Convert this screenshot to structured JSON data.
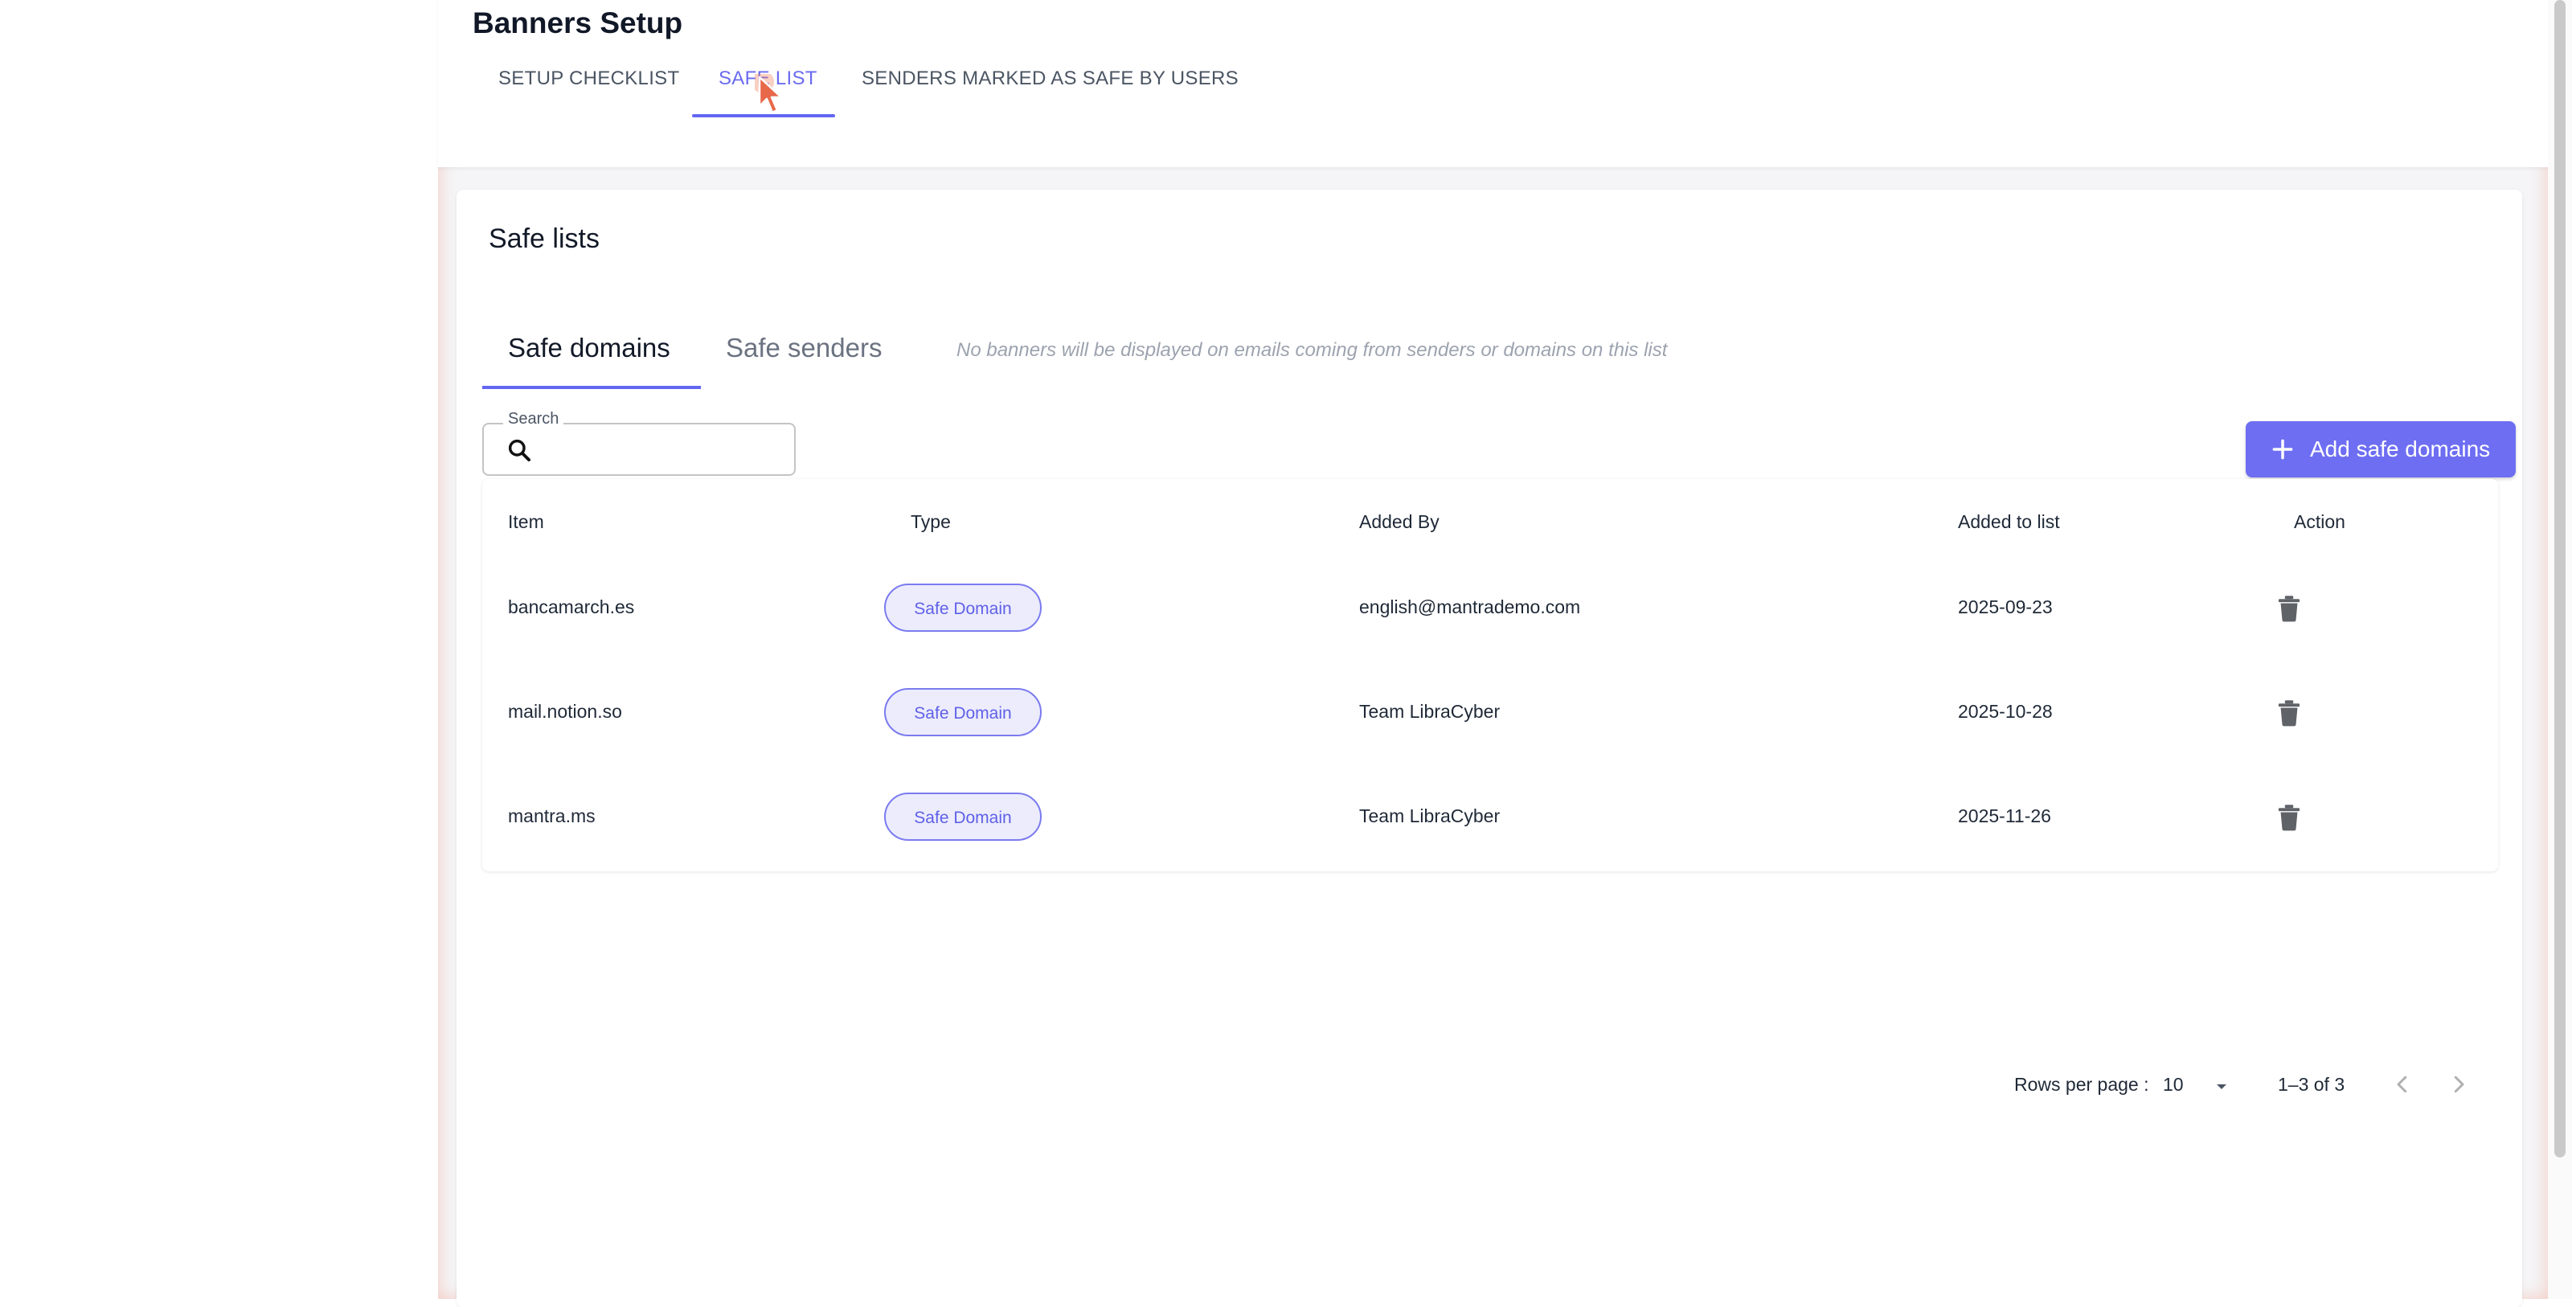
{
  "header": {
    "title": "Banners Setup",
    "tabs": [
      {
        "label": "SETUP CHECKLIST",
        "active": false
      },
      {
        "label": "SAFE LIST",
        "active": true
      },
      {
        "label": "SENDERS MARKED AS SAFE BY USERS",
        "active": false
      }
    ]
  },
  "card": {
    "title": "Safe lists",
    "tabs": [
      {
        "label": "Safe domains",
        "active": true
      },
      {
        "label": "Safe senders",
        "active": false
      }
    ],
    "hint": "No banners will be displayed on emails coming from senders or domains on this list",
    "search": {
      "label": "Search",
      "value": ""
    },
    "add_button": {
      "label": "Add safe domains"
    },
    "table": {
      "columns": [
        "Item",
        "Type",
        "Added By",
        "Added to list",
        "Action"
      ],
      "rows": [
        {
          "item": "bancamarch.es",
          "type": "Safe Domain",
          "added_by": "english@mantrademo.com",
          "added_to_list": "2025-09-23"
        },
        {
          "item": "mail.notion.so",
          "type": "Safe Domain",
          "added_by": "Team LibraCyber",
          "added_to_list": "2025-10-28"
        },
        {
          "item": "mantra.ms",
          "type": "Safe Domain",
          "added_by": "Team LibraCyber",
          "added_to_list": "2025-11-26"
        }
      ]
    },
    "pagination": {
      "rows_per_page_label": "Rows per page :",
      "rows_per_page": "10",
      "range": "1–3 of 3"
    }
  },
  "colors": {
    "accent": "#6366f1",
    "button": "#6e6ef3",
    "chip_bg": "#ececfd"
  }
}
